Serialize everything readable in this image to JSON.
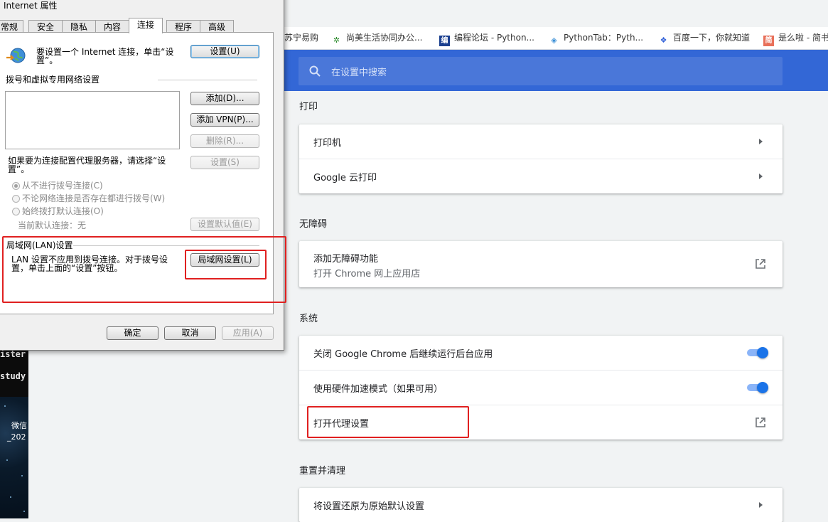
{
  "bookmarks": [
    {
      "label": "苏宁易购",
      "icon": "suning-icon"
    },
    {
      "label": "尚美生活协同办公...",
      "icon": "shangmei-icon"
    },
    {
      "label": "编程论坛 - Python...",
      "icon": "bccn-icon"
    },
    {
      "label": "PythonTab：Pyth...",
      "icon": "pythontab-icon"
    },
    {
      "label": "百度一下，你就知道",
      "icon": "baidu-paw-icon"
    },
    {
      "label": "是么啦 - 简书",
      "icon": "jianshu-icon"
    }
  ],
  "settings": {
    "search_placeholder": "在设置中搜索",
    "print": {
      "title": "打印",
      "printer": "打印机",
      "cloud_print": "Google 云打印"
    },
    "accessibility": {
      "title": "无障碍",
      "add_feature": "添加无障碍功能",
      "add_feature_sub": "打开 Chrome 网上应用店"
    },
    "system": {
      "title": "系统",
      "background_apps": "关闭 Google Chrome 后继续运行后台应用",
      "background_apps_on": true,
      "hardware_accel": "使用硬件加速模式（如果可用）",
      "hardware_accel_on": true,
      "proxy": "打开代理设置"
    },
    "reset": {
      "title": "重置并清理",
      "restore_defaults": "将设置还原为原始默认设置"
    }
  },
  "dialog": {
    "title": "Internet 属性",
    "tabs": [
      "常规",
      "安全",
      "隐私",
      "内容",
      "连接",
      "程序",
      "高级"
    ],
    "active_tab": "连接",
    "setup_text_1": "要设置一个 Internet 连接，单击“设",
    "setup_text_2": "置”。",
    "setup_button": "设置(U)",
    "dialup_group": "拨号和虚拟专用网络设置",
    "add_button": "添加(D)...",
    "add_vpn_button": "添加 VPN(P)...",
    "remove_button": "删除(R)...",
    "proxy_text_1": "如果要为连接配置代理服务器，请选择“设",
    "proxy_text_2": "置”。",
    "settings_button": "设置(S)",
    "radio_never": "从不进行拨号连接(C)",
    "radio_whenever": "不论网络连接是否存在都进行拨号(W)",
    "radio_always": "始终拨打默认连接(O)",
    "current_default": "当前默认连接：无",
    "set_default_button": "设置默认值(E)",
    "lan_group": "局域网(LAN)设置",
    "lan_text_1": "LAN 设置不应用到拨号连接。对于拨号设",
    "lan_text_2": "置，单击上面的“设置”按钮。",
    "lan_button": "局域网设置(L)",
    "ok_button": "确定",
    "cancel_button": "取消",
    "apply_button": "应用(A)"
  },
  "background": {
    "terminal_line_1": "ister",
    "terminal_line_2": "study",
    "desktop_label_1": "微信",
    "desktop_label_2": "_202"
  }
}
